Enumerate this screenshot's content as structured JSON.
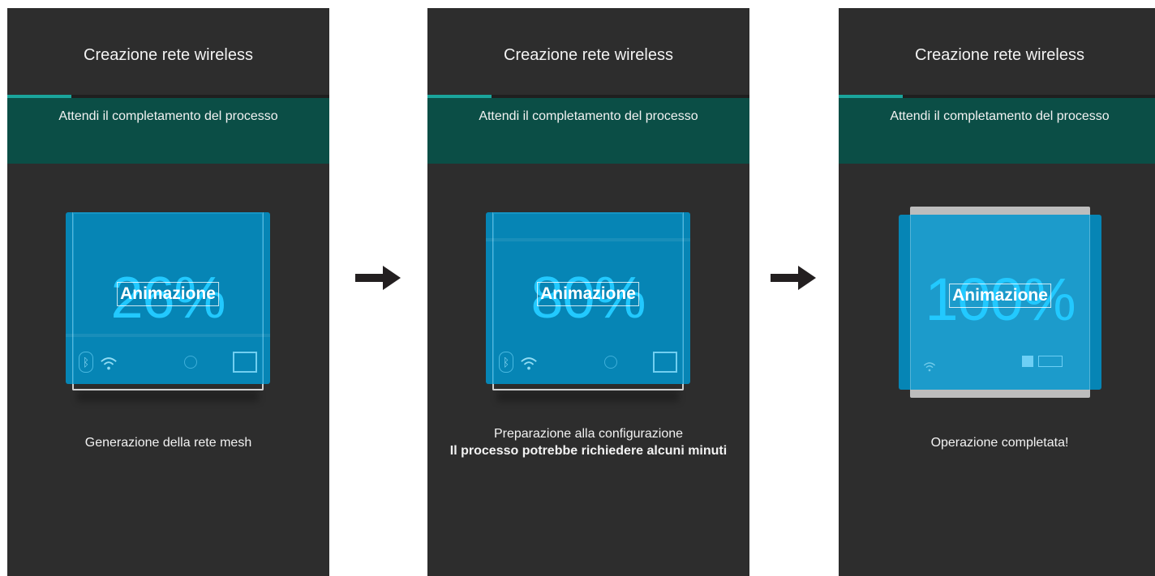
{
  "screens": [
    {
      "title": "Creazione rete wireless",
      "banner": "Attendi il completamento del processo",
      "progress_fraction": 0.2,
      "percent": "26%",
      "animation_label": "Animazione",
      "status_line1": "Generazione della rete mesh",
      "status_line2": ""
    },
    {
      "title": "Creazione rete wireless",
      "banner": "Attendi il completamento del processo",
      "progress_fraction": 0.2,
      "percent": "80%",
      "animation_label": "Animazione",
      "status_line1": "Preparazione alla configurazione",
      "status_line2": "Il processo potrebbe richiedere alcuni minuti"
    },
    {
      "title": "Creazione rete wireless",
      "banner": "Attendi il completamento del processo",
      "progress_fraction": 0.2,
      "percent": "100%",
      "animation_label": "Animazione",
      "status_line1": "Operazione completata!",
      "status_line2": ""
    }
  ],
  "icons": [
    "bluetooth-icon",
    "wifi-icon",
    "dot-icon",
    "square-icon",
    "arrow-right-icon"
  ],
  "colors": {
    "screen_bg": "#2d2d2d",
    "banner_bg": "#0b4e46",
    "progress": "#1aa59c",
    "device_blue": "#0095ce",
    "percent_text": "#22c9ff",
    "arrow": "#231f20"
  }
}
